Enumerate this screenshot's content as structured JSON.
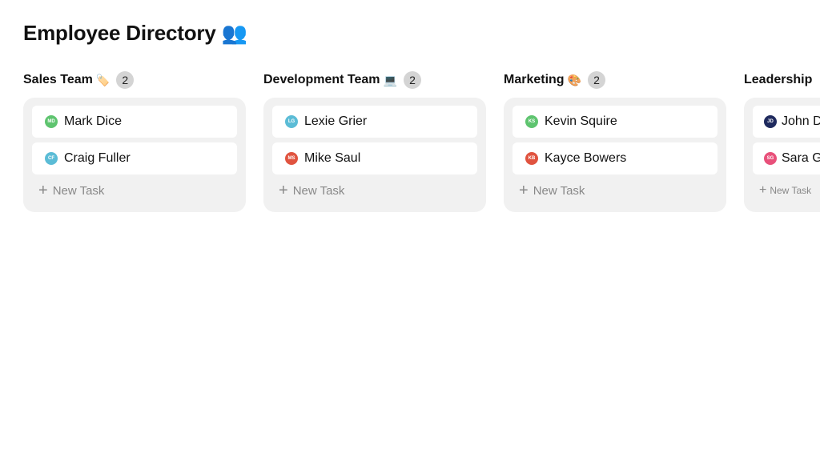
{
  "title": "Employee Directory",
  "title_emoji": "👥",
  "new_task_label": "New Task",
  "columns": [
    {
      "name": "Sales Team",
      "emoji": "🏷️",
      "count": "2",
      "members": [
        {
          "initials": "MD",
          "name": "Mark Dice",
          "color": "#5ec46f"
        },
        {
          "initials": "CF",
          "name": "Craig Fuller",
          "color": "#5bbcd6"
        }
      ]
    },
    {
      "name": "Development Team",
      "emoji": "💻",
      "count": "2",
      "members": [
        {
          "initials": "LG",
          "name": "Lexie Grier",
          "color": "#5bbcd6"
        },
        {
          "initials": "MS",
          "name": "Mike Saul",
          "color": "#e0533f"
        }
      ]
    },
    {
      "name": "Marketing",
      "emoji": "🎨",
      "count": "2",
      "members": [
        {
          "initials": "KS",
          "name": "Kevin Squire",
          "color": "#5ec46f"
        },
        {
          "initials": "KB",
          "name": "Kayce Bowers",
          "color": "#e0533f"
        }
      ]
    },
    {
      "name": "Leadership",
      "emoji": "",
      "count": "",
      "members": [
        {
          "initials": "JD",
          "name": "John D",
          "color": "#1f2a5e"
        },
        {
          "initials": "SG",
          "name": "Sara G",
          "color": "#e8507a"
        }
      ]
    }
  ]
}
